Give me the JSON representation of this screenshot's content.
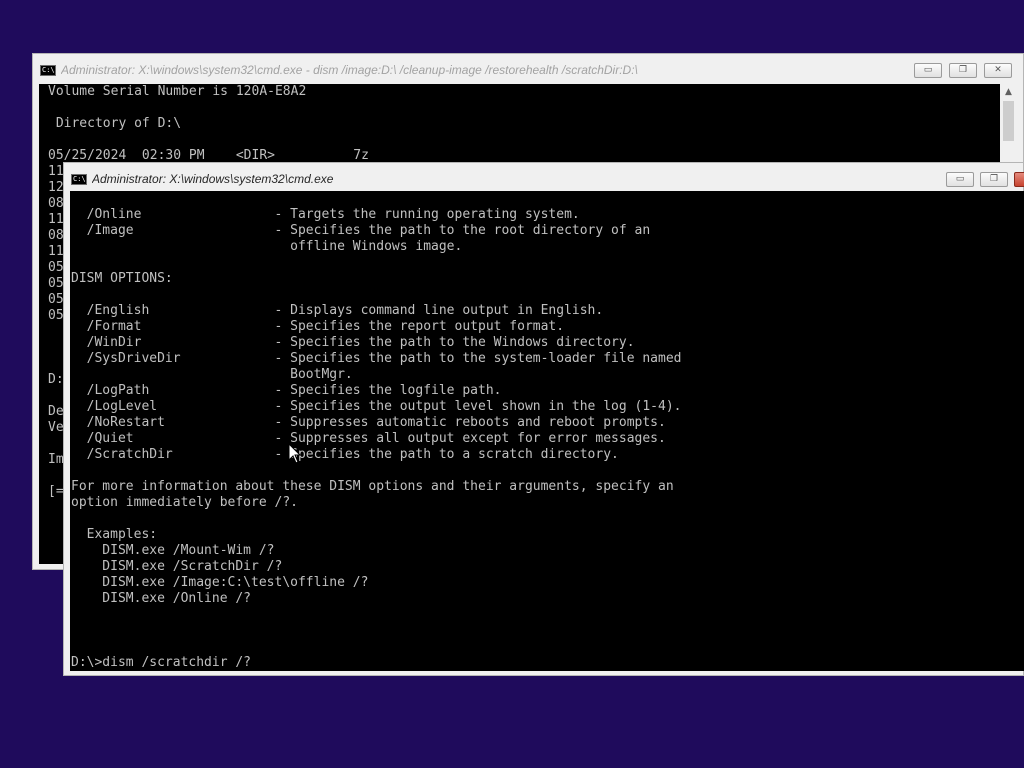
{
  "back_window": {
    "title": "Administrator: X:\\windows\\system32\\cmd.exe - dism  /image:D:\\ /cleanup-image /restorehealth /scratchDir:D:\\",
    "icon_text": "C:\\.",
    "lines": [
      "Volume Serial Number is 120A-E8A2",
      "",
      " Directory of D:\\",
      "",
      "05/25/2024  02:30 PM    <DIR>          7z",
      "11/",
      "12/",
      "08/",
      "11/",
      "08/",
      "11/",
      "05/",
      "05/",
      "05/",
      "05/",
      "",
      "",
      "",
      "D:\\",
      "",
      "Dep",
      "Ver",
      "",
      "Ima",
      "",
      "[=="
    ],
    "buttons": {
      "minimize": "▭",
      "maximize": "❐",
      "close": "✕"
    }
  },
  "front_window": {
    "title": "Administrator: X:\\windows\\system32\\cmd.exe",
    "icon_text": "C:\\.",
    "lines": [
      "  /Online                 - Targets the running operating system.",
      "  /Image                  - Specifies the path to the root directory of an",
      "                            offline Windows image.",
      "",
      "DISM OPTIONS:",
      "",
      "  /English                - Displays command line output in English.",
      "  /Format                 - Specifies the report output format.",
      "  /WinDir                 - Specifies the path to the Windows directory.",
      "  /SysDriveDir            - Specifies the path to the system-loader file named",
      "                            BootMgr.",
      "  /LogPath                - Specifies the logfile path.",
      "  /LogLevel               - Specifies the output level shown in the log (1-4).",
      "  /NoRestart              - Suppresses automatic reboots and reboot prompts.",
      "  /Quiet                  - Suppresses all output except for error messages.",
      "  /ScratchDir             - Specifies the path to a scratch directory.",
      "",
      "For more information about these DISM options and their arguments, specify an",
      "option immediately before /?.",
      "",
      "  Examples:",
      "    DISM.exe /Mount-Wim /?",
      "    DISM.exe /ScratchDir /?",
      "    DISM.exe /Image:C:\\test\\offline /?",
      "    DISM.exe /Online /?",
      "",
      "",
      "",
      "D:\\>dism /scratchdir /?"
    ],
    "buttons": {
      "minimize": "▭",
      "maximize": "❐",
      "close": "✕"
    }
  }
}
